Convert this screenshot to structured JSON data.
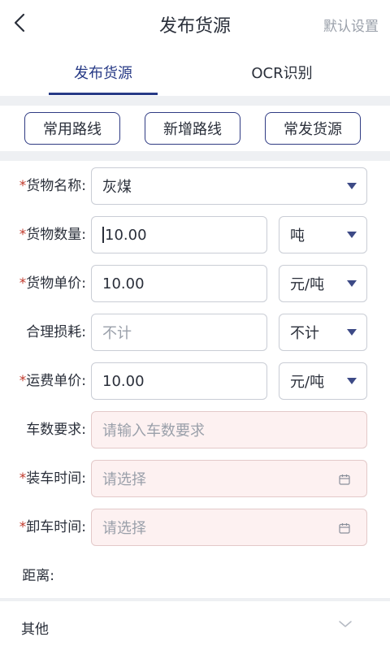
{
  "header": {
    "title": "发布货源",
    "right_action": "默认设置"
  },
  "tabs": [
    {
      "label": "发布货源",
      "active": true
    },
    {
      "label": "OCR识别",
      "active": false
    }
  ],
  "route_buttons": [
    "常用路线",
    "新增路线",
    "常发货源"
  ],
  "form": {
    "cargo_name": {
      "label": "货物名称:",
      "value": "灰煤"
    },
    "cargo_qty": {
      "label": "货物数量:",
      "value": "10.00",
      "unit": "吨"
    },
    "cargo_price": {
      "label": "货物单价:",
      "value": "10.00",
      "unit": "元/吨"
    },
    "loss": {
      "label": "合理损耗:",
      "placeholder": "不计",
      "unit": "不计"
    },
    "freight_price": {
      "label": "运费单价:",
      "value": "10.00",
      "unit": "元/吨"
    },
    "vehicle_req": {
      "label": "车数要求:",
      "placeholder": "请输入车数要求"
    },
    "load_time": {
      "label": "装车时间:",
      "placeholder": "请选择"
    },
    "unload_time": {
      "label": "卸车时间:",
      "placeholder": "请选择"
    },
    "distance": {
      "label": "距离:"
    }
  },
  "required_mark": "*",
  "other": {
    "label": "其他"
  },
  "colors": {
    "accent": "#273a86",
    "required": "#c0392b",
    "pink_field": "#fdf1f1"
  }
}
